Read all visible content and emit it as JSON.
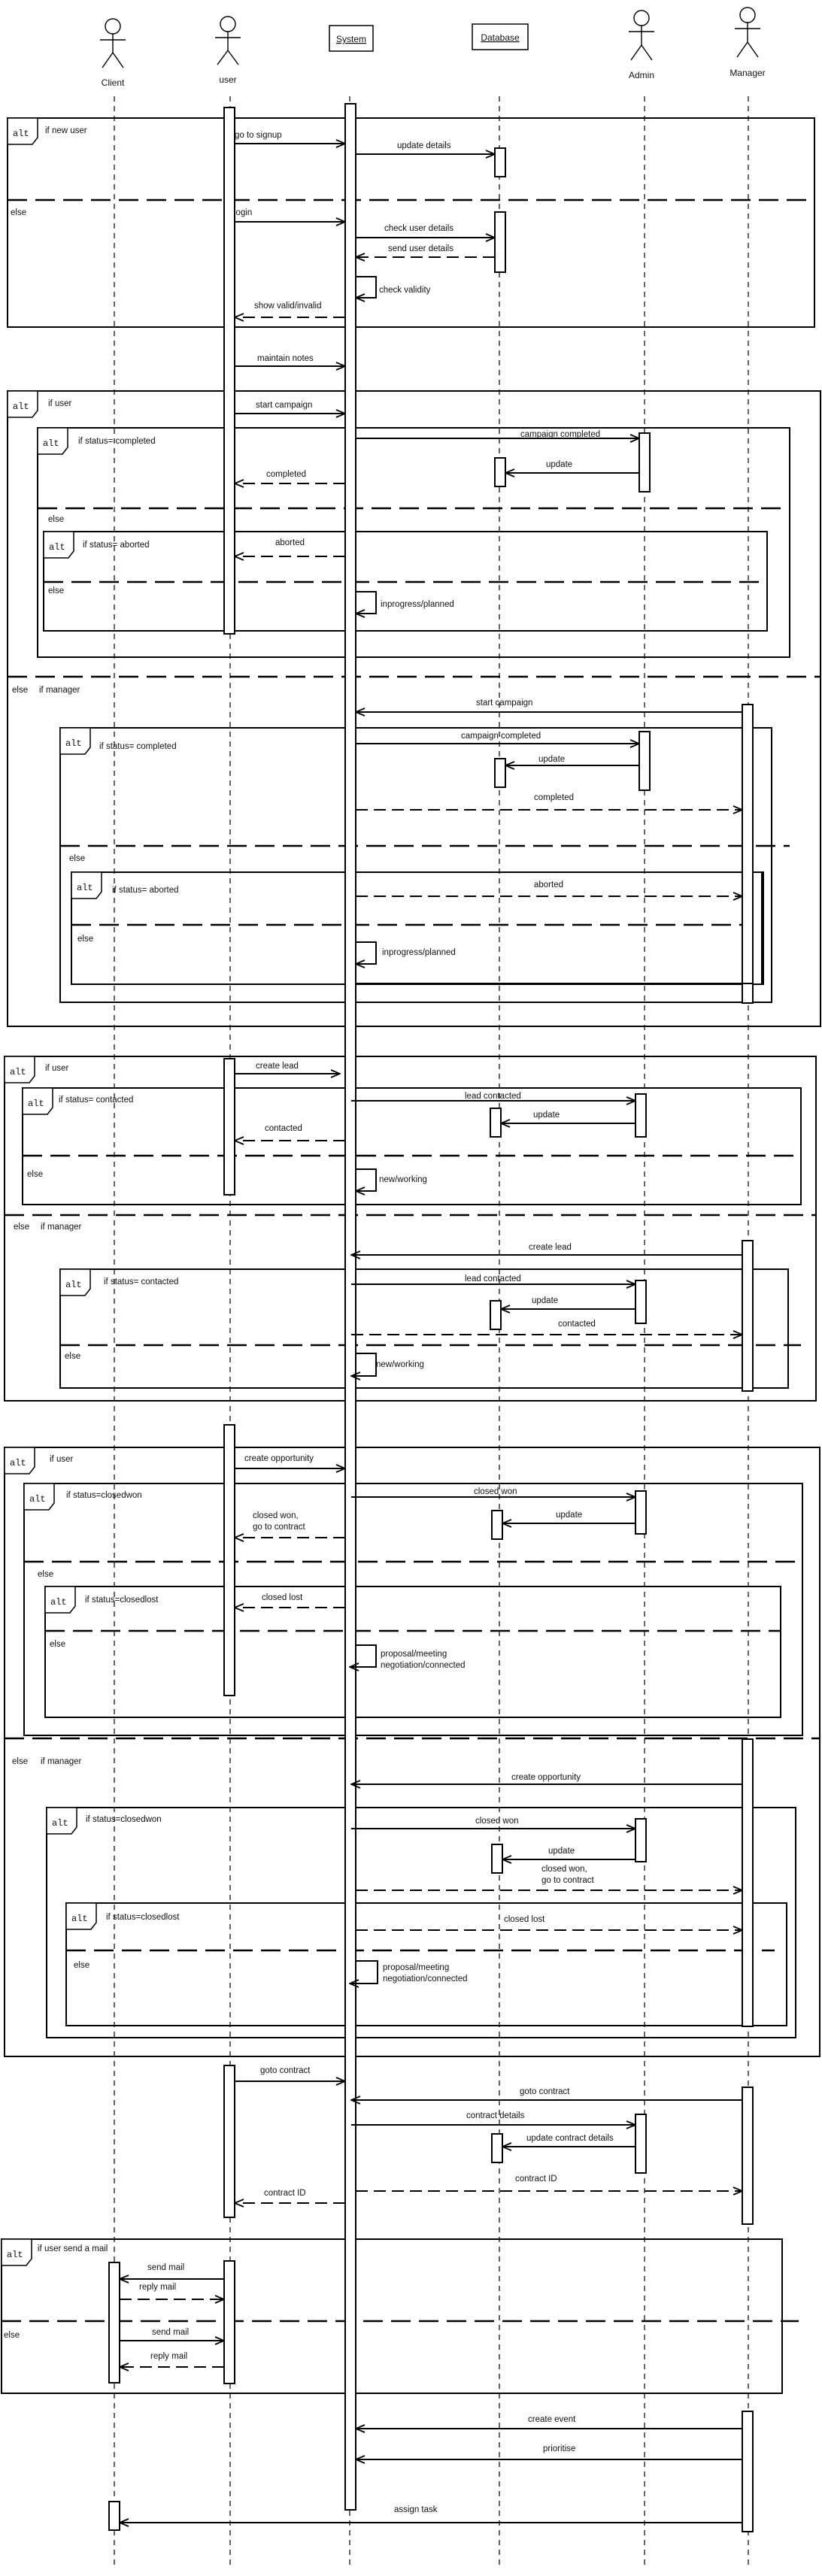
{
  "participants": {
    "client": "Client",
    "user": "user",
    "system": "System",
    "database": "Database",
    "admin": "Admin",
    "manager": "Manager"
  },
  "fragment_keyword": "alt",
  "else_keyword": "else",
  "signup": {
    "guard": "if new user",
    "go_to_signup": "go to signup",
    "update_details": "update details",
    "login": "login",
    "check_user_details": "check user details",
    "send_user_details": "send user details",
    "check_validity": "check validity",
    "show_valid_invalid": "show valid/invalid",
    "maintain_notes": "maintain notes"
  },
  "campaign": {
    "guard_user": "if user",
    "start_campaign_user": "start campaign",
    "guard_completed": "if status= completed",
    "campaign_completed": "campaign completed",
    "update": "update",
    "completed": "completed",
    "guard_aborted": "if status= aborted",
    "aborted": "aborted",
    "inprogress": "inprogress/planned",
    "guard_manager": "if manager",
    "start_campaign_manager": "start campaign",
    "campaign_completed_m": "campaign completed",
    "update_m": "update",
    "completed_m": "completed",
    "guard_completed_m": "if status= completed",
    "guard_aborted_m": "if status= aborted",
    "aborted_m": "aborted",
    "inprogress_m": "inprogress/planned"
  },
  "lead": {
    "guard_user": "if user",
    "create_lead": "create lead",
    "guard_contacted": "if status= contacted",
    "lead_contacted": "lead contacted",
    "update": "update",
    "contacted": "contacted",
    "new_working": "new/working",
    "guard_manager": "if manager",
    "create_lead_m": "create lead",
    "guard_contacted_m": "if status= contacted",
    "lead_contacted_m": "lead contacted",
    "update_m": "update",
    "contacted_m": "contacted",
    "new_working_m": "new/working"
  },
  "opportunity": {
    "guard_user": "if user",
    "create_opportunity": "create opportunity",
    "guard_closedwon": "if status=closedwon",
    "closed_won": "closed won",
    "update": "update",
    "closed_won_contract_1": "closed won,",
    "closed_won_contract_2": "go to contract",
    "guard_closedlost": "if status=closedlost",
    "closed_lost": "closed lost",
    "proposal_1": "proposal/meeting",
    "proposal_2": "negotiation/connected",
    "guard_manager": "if manager",
    "create_opportunity_m": "create opportunity",
    "guard_closedwon_m": "if status=closedwon",
    "closed_won_m": "closed won",
    "update_m": "update",
    "closed_won_contract_m1": "closed won,",
    "closed_won_contract_m2": "go to contract",
    "guard_closedlost_m": "if status=closedlost",
    "closed_lost_m": "closed lost",
    "proposal_m1": "proposal/meeting",
    "proposal_m2": "negotiation/connected"
  },
  "contract": {
    "goto_contract_user": "goto contract",
    "goto_contract_manager": "goto contract",
    "contract_details": "contract details",
    "update_contract_details": "update contract details",
    "contract_id_m": "contract ID",
    "contract_id_u": "contract ID"
  },
  "mail": {
    "guard": "if user send a mail",
    "send_mail_1": "send mail",
    "reply_mail_1": "reply mail",
    "send_mail_2": "send mail",
    "reply_mail_2": "reply mail"
  },
  "events": {
    "create_event": "create event",
    "prioritise": "prioritise",
    "assign_task": "assign task"
  }
}
